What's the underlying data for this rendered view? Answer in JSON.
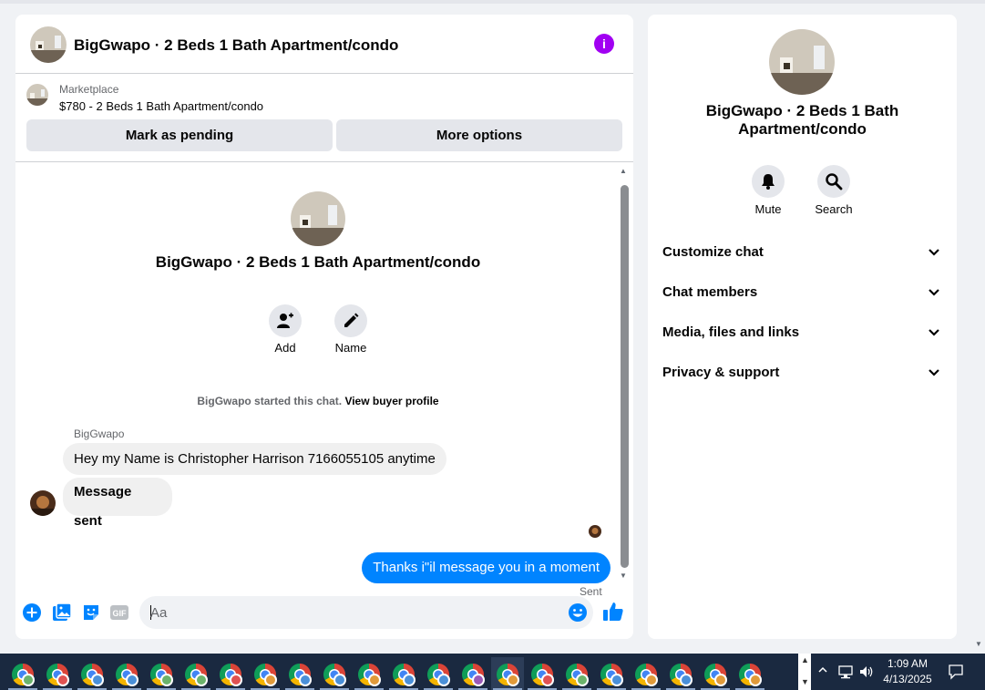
{
  "chat": {
    "title": "BigGwapo · 2 Beds 1 Bath Apartment/condo",
    "info_icon_label": "i",
    "listing": {
      "source": "Marketplace",
      "summary": "$780 - 2 Beds 1 Bath Apartment/condo",
      "mark_pending_label": "Mark as pending",
      "more_options_label": "More options"
    },
    "intro": {
      "title": "BigGwapo · 2 Beds 1 Bath Apartment/condo",
      "add_label": "Add",
      "name_label": "Name",
      "started_text": "BigGwapo started this chat.",
      "view_profile_link": "View buyer profile"
    },
    "messages": {
      "sender_name": "BigGwapo",
      "incoming_1": "Hey my Name is Christopher Harrison 7166055105 anytime",
      "incoming_2": "Message sent",
      "outgoing_1": "Thanks i\"il message you in a moment",
      "outgoing_status": "Sent"
    },
    "composer": {
      "placeholder": "Aa"
    }
  },
  "info_panel": {
    "title": "BigGwapo · 2 Beds 1 Bath Apartment/condo",
    "mute_label": "Mute",
    "search_label": "Search",
    "sections": [
      "Customize chat",
      "Chat members",
      "Media, files and links",
      "Privacy & support"
    ]
  },
  "taskbar": {
    "time": "1:09 AM",
    "date": "4/13/2025",
    "badge_colors": [
      "#6bb36b",
      "#e05252",
      "#4a90d9",
      "#4a90d9",
      "#6bb36b",
      "#6bb36b",
      "#e05252",
      "#e09a3a",
      "#4a90d9",
      "#4a90d9",
      "#e09a3a",
      "#4a90d9",
      "#4a90d9",
      "#9b59b6",
      "#e09a3a",
      "#e05252",
      "#6bb36b",
      "#4a90d9",
      "#e09a3a",
      "#4a90d9",
      "#e09a3a",
      "#e09a3a"
    ]
  },
  "colors": {
    "accent": "#0084ff",
    "info_icon": "#a100f2",
    "taskbar": "#1a2940"
  }
}
